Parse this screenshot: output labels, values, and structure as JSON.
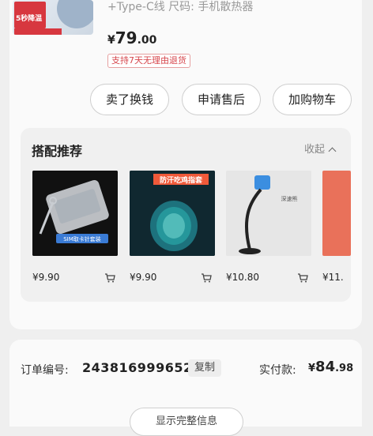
{
  "product": {
    "spec_text": "+Type-C线  尺码: 手机散热器",
    "price_currency": "¥",
    "price_int": "79",
    "price_dec": ".00",
    "return_badge": "支持7天无理由退货",
    "thumb_text": "5秒降温"
  },
  "actions": {
    "sell": "卖了换钱",
    "aftersale": "申请售后",
    "add_cart": "加购物车"
  },
  "recommend": {
    "title": "搭配推荐",
    "collapse_label": "收起",
    "items": [
      {
        "price": "¥9.90",
        "caption": "SIM取卡针套装"
      },
      {
        "price": "¥9.90",
        "caption": "防汗吃鸡指套"
      },
      {
        "price": "¥10.80",
        "caption": "深速熊"
      },
      {
        "price": "¥11."
      }
    ]
  },
  "order": {
    "no_label": "订单编号:",
    "no_value": "243816999652",
    "copy_label": "复制",
    "paid_label": "实付款:",
    "paid_currency": "¥",
    "paid_int": "84",
    "paid_dec": ".98",
    "more_label": "显示完整信息"
  },
  "colors": {
    "accent_red": "#d6454b",
    "background": "#efefef",
    "card": "#fafafa"
  }
}
